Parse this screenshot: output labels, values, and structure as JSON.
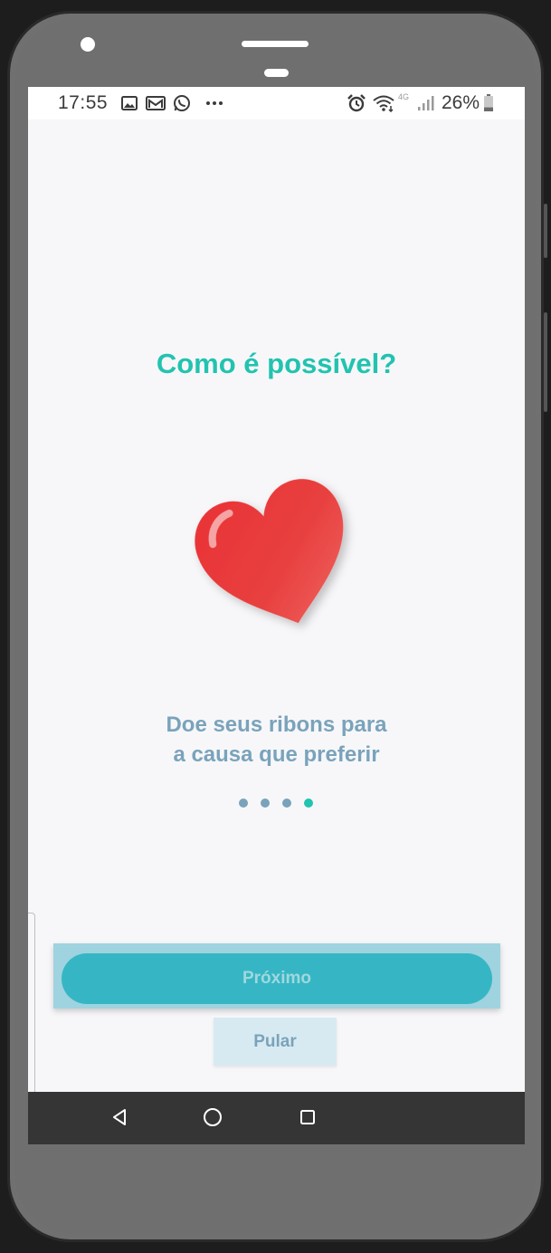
{
  "status_bar": {
    "time": "17:55",
    "left_icons": [
      "gallery-icon",
      "gmail-icon",
      "whatsapp-icon",
      "more-notifications-icon"
    ],
    "right_icons": [
      "alarm-icon",
      "wifi-icon",
      "network-4g-icon",
      "signal-icon"
    ],
    "network_label": "4G",
    "battery_percent": "26%",
    "battery_level": 0.26
  },
  "onboarding": {
    "title": "Como é possível?",
    "illustration": "heart-icon",
    "subtitle_line1": "Doe seus ribons para",
    "subtitle_line2": "a causa que preferir",
    "pagination": {
      "total": 4,
      "active_index": 3
    },
    "next_label": "Próximo",
    "skip_label": "Pular"
  },
  "nav_bar": {
    "buttons": [
      "back-icon",
      "home-icon",
      "recents-icon"
    ]
  },
  "colors": {
    "accent": "#22c3b0",
    "muted_text": "#7aa3bb",
    "button": "#36b6c4",
    "heart": "#e8373b"
  }
}
